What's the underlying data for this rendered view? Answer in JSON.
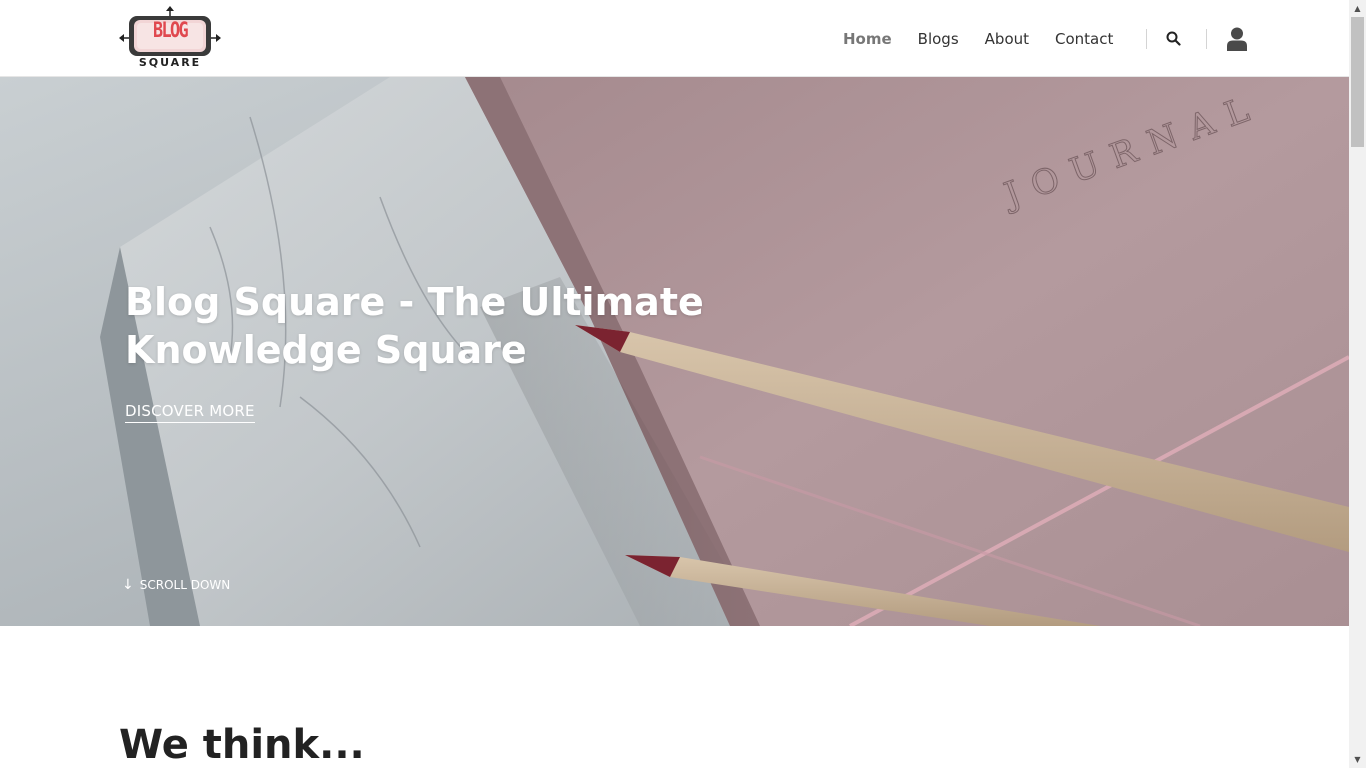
{
  "header": {
    "logo": {
      "blog_text": "BLOG",
      "square_text": "SQUARE"
    },
    "nav": [
      {
        "label": "Home",
        "active": true
      },
      {
        "label": "Blogs",
        "active": false
      },
      {
        "label": "About",
        "active": false
      },
      {
        "label": "Contact",
        "active": false
      }
    ],
    "icons": {
      "search": "search-icon",
      "user": "user-icon"
    }
  },
  "hero": {
    "title": "Blog Square - The Ultimate Knowledge Square",
    "cta": "DISCOVER MORE",
    "scroll": "SCROLL DOWN",
    "journal_text": "JOURNAL"
  },
  "section": {
    "title": "We think..."
  },
  "colors": {
    "accent": "#e0484f",
    "text_dark": "#222222",
    "nav_active": "#777777"
  }
}
